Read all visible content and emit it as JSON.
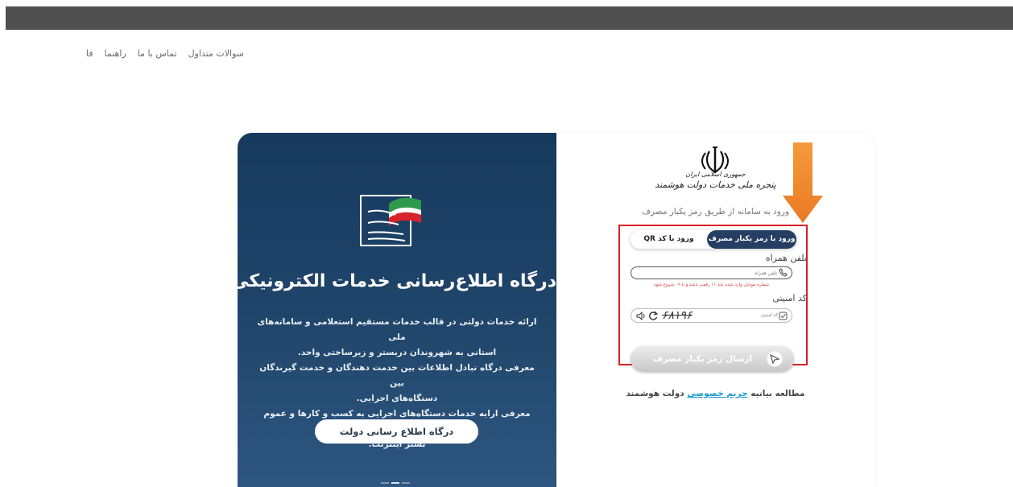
{
  "nav": {
    "items": [
      "سوالات متداول",
      "تماس با ما",
      "راهنما",
      "فا"
    ]
  },
  "left": {
    "title": "درگاه اطلاع‌رسانی خدمات الکترونیکی دولت",
    "description": [
      "ارائه خدمات دولتی در قالب خدمات مستقیم استعلامی و سامانه‌های ملی",
      "استانی به شهروندان دربستر و زیرساختی واحد.",
      "معرفی درگاه تبادل اطلاعات بین خدمت دهندگان و خدمت گیرندگان بین",
      "دستگاه‌های اجرایی.",
      "معرفی ارایه خدمات دستگاه‌های اجرایی به کسب و کارها و عموم مردم از",
      "بستر اینترنت."
    ],
    "button_label": "درگاه اطلاع رسانی دولت"
  },
  "login": {
    "logo_line1": "جمهوری اسلامی ایران",
    "logo_line2": "پنجره ملی خدمات دولت هوشمند",
    "subtitle": "ورود به سامانه از طریق رمز یکبار مصرف",
    "tab_otp": "ورود با رمز یکبار مصرف",
    "tab_qr": "ورود با کد QR",
    "phone_label": "تلفن همراه",
    "phone_placeholder": "تلفن همراه",
    "phone_hint": "شماره موبایل وارد شده باید ۱۱ رقمی باشد و با ۰۹ شروع شود",
    "captcha_label": "کد امنیتی",
    "captcha_placeholder": "کد امنیتی",
    "captcha_code": "۶۸۱۹۶",
    "send_button": "ارسال رمز یکبار مصرف",
    "privacy_prefix": "مطالعه بیانیه",
    "privacy_link": "حریم خصوصی",
    "privacy_suffix": "دولت هوشمند"
  },
  "colors": {
    "top_bar": "#505050",
    "panel_dark": "#1c3f63",
    "tab_active": "#253f64",
    "highlight": "#d81f26",
    "arrow": "#f0802a",
    "link": "#1c9ad6"
  }
}
